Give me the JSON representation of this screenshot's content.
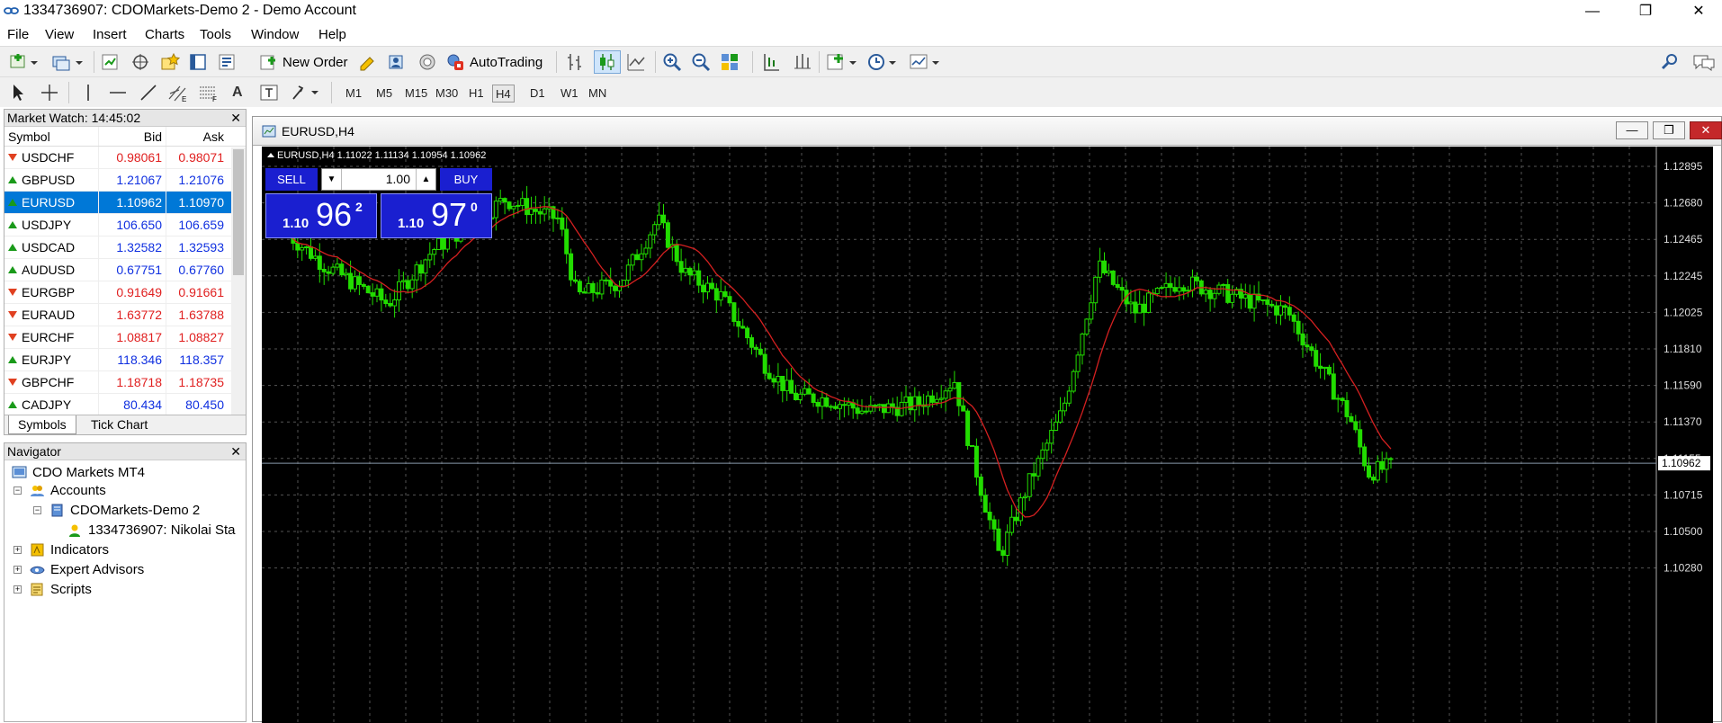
{
  "window": {
    "title": "1334736907: CDOMarkets-Demo 2 - Demo Account",
    "controls": [
      "—",
      "❐",
      "✕"
    ]
  },
  "menu": [
    "File",
    "View",
    "Insert",
    "Charts",
    "Tools",
    "Window",
    "Help"
  ],
  "toolbar": {
    "new_order": "New Order",
    "autotrading": "AutoTrading"
  },
  "timeframes": [
    "M1",
    "M5",
    "M15",
    "M30",
    "H1",
    "H4",
    "D1",
    "W1",
    "MN"
  ],
  "active_timeframe": "H4",
  "market_watch": {
    "title": "Market Watch: 14:45:02",
    "close": "✕",
    "columns": [
      "Symbol",
      "Bid",
      "Ask"
    ],
    "rows": [
      {
        "symbol": "USDCHF",
        "bid": "0.98061",
        "ask": "0.98071",
        "dir": "down",
        "color": "#e02020"
      },
      {
        "symbol": "GBPUSD",
        "bid": "1.21067",
        "ask": "1.21076",
        "dir": "up",
        "color": "#1030e0"
      },
      {
        "symbol": "EURUSD",
        "bid": "1.10962",
        "ask": "1.10970",
        "dir": "up",
        "color": "#ffffff"
      },
      {
        "symbol": "USDJPY",
        "bid": "106.650",
        "ask": "106.659",
        "dir": "up",
        "color": "#1030e0"
      },
      {
        "symbol": "USDCAD",
        "bid": "1.32582",
        "ask": "1.32593",
        "dir": "up",
        "color": "#1030e0"
      },
      {
        "symbol": "AUDUSD",
        "bid": "0.67751",
        "ask": "0.67760",
        "dir": "up",
        "color": "#1030e0"
      },
      {
        "symbol": "EURGBP",
        "bid": "0.91649",
        "ask": "0.91661",
        "dir": "down",
        "color": "#e02020"
      },
      {
        "symbol": "EURAUD",
        "bid": "1.63772",
        "ask": "1.63788",
        "dir": "down",
        "color": "#e02020"
      },
      {
        "symbol": "EURCHF",
        "bid": "1.08817",
        "ask": "1.08827",
        "dir": "down",
        "color": "#e02020"
      },
      {
        "symbol": "EURJPY",
        "bid": "118.346",
        "ask": "118.357",
        "dir": "up",
        "color": "#1030e0"
      },
      {
        "symbol": "GBPCHF",
        "bid": "1.18718",
        "ask": "1.18735",
        "dir": "down",
        "color": "#e02020"
      },
      {
        "symbol": "CADJPY",
        "bid": "80.434",
        "ask": "80.450",
        "dir": "up",
        "color": "#1030e0"
      }
    ],
    "selected": "EURUSD",
    "tabs": [
      "Symbols",
      "Tick Chart"
    ]
  },
  "navigator": {
    "title": "Navigator",
    "close": "✕",
    "root": "CDO Markets MT4",
    "accounts": "Accounts",
    "server": "CDOMarkets-Demo 2",
    "account": "1334736907: Nikolai Sta",
    "indicators": "Indicators",
    "expert_advisors": "Expert Advisors",
    "scripts": "Scripts"
  },
  "chart": {
    "window_title": "EURUSD,H4",
    "info": "EURUSD,H4  1.11022 1.11134 1.10954 1.10962",
    "price_levels": [
      "1.12895",
      "1.12680",
      "1.12465",
      "1.12245",
      "1.12025",
      "1.11810",
      "1.11590",
      "1.11370",
      "1.11155",
      "1.10962",
      "1.10715",
      "1.10500",
      "1.10280"
    ],
    "current_price": "1.10962",
    "sell": {
      "label": "SELL",
      "prefix": "1.10",
      "big": "96",
      "sup": "2"
    },
    "buy": {
      "label": "BUY",
      "prefix": "1.10",
      "big": "97",
      "sup": "0"
    },
    "lot": "1.00",
    "colors": {
      "bg": "#000000",
      "candle": "#22dd00",
      "ma": "#d42020",
      "grid": "#555555",
      "panel": "#1a1fd0"
    }
  }
}
